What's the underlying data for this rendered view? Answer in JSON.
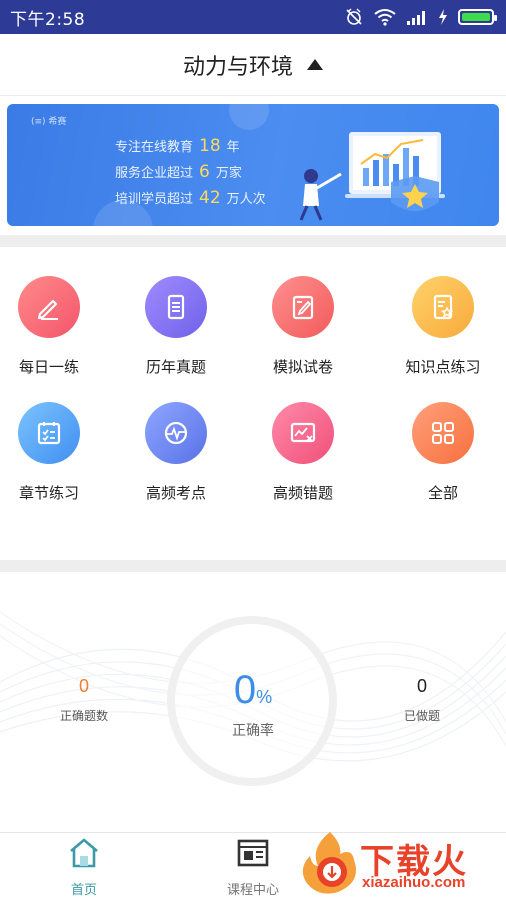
{
  "status_bar": {
    "time": "下午2:58",
    "icons": [
      "alarm-off-icon",
      "wifi-icon",
      "signal-icon",
      "charging-icon",
      "battery-icon"
    ]
  },
  "header": {
    "title": "动力与环境",
    "caret_icon": "caret-up-icon"
  },
  "banner": {
    "logo_text": "(≡) 希赛",
    "lines": [
      {
        "prefix": "专注在线教育",
        "number": "18",
        "suffix": "年"
      },
      {
        "prefix": "服务企业超过",
        "number": "6",
        "suffix": "万家"
      },
      {
        "prefix": "培训学员超过",
        "number": "42",
        "suffix": "万人次"
      }
    ]
  },
  "features": [
    {
      "label": "每日一练",
      "icon": "pencil-icon",
      "color_from": "#ff8a8a",
      "color_to": "#f3566b"
    },
    {
      "label": "历年真题",
      "icon": "document-icon",
      "color_from": "#a08bff",
      "color_to": "#6f62e8"
    },
    {
      "label": "模拟试卷",
      "icon": "edit-paper-icon",
      "color_from": "#ff8f8f",
      "color_to": "#f25b5b"
    },
    {
      "label": "知识点练习",
      "icon": "knowledge-icon",
      "color_from": "#ffd36b",
      "color_to": "#f9a93a"
    },
    {
      "label": "章节练习",
      "icon": "checklist-icon",
      "color_from": "#7cc3ff",
      "color_to": "#3f8ff0"
    },
    {
      "label": "高频考点",
      "icon": "pulse-icon",
      "color_from": "#8ea6ff",
      "color_to": "#5a72e6"
    },
    {
      "label": "高频错题",
      "icon": "error-chart-icon",
      "color_from": "#ff8aa8",
      "color_to": "#f0507a"
    },
    {
      "label": "全部",
      "icon": "grid-icon",
      "color_from": "#ffa07a",
      "color_to": "#f7703e"
    }
  ],
  "stats": {
    "correct_count": "0",
    "correct_count_label": "正确题数",
    "rate_value": "0",
    "rate_unit": "%",
    "rate_label": "正确率",
    "done_count": "0",
    "done_count_label": "已做题"
  },
  "bottom_nav": [
    {
      "label": "首页",
      "icon": "home-icon",
      "active": true
    },
    {
      "label": "课程中心",
      "icon": "course-icon",
      "active": false
    }
  ],
  "watermark": {
    "text": "下载火",
    "url": "xiazaihuo.com"
  },
  "colors": {
    "status_bar": "#2d3b96",
    "banner": "#3a7be6",
    "accent_blue": "#3c8ee6",
    "correct_count": "#f57c2b",
    "active_nav": "#3a9aa8",
    "watermark": "#e8422a"
  }
}
